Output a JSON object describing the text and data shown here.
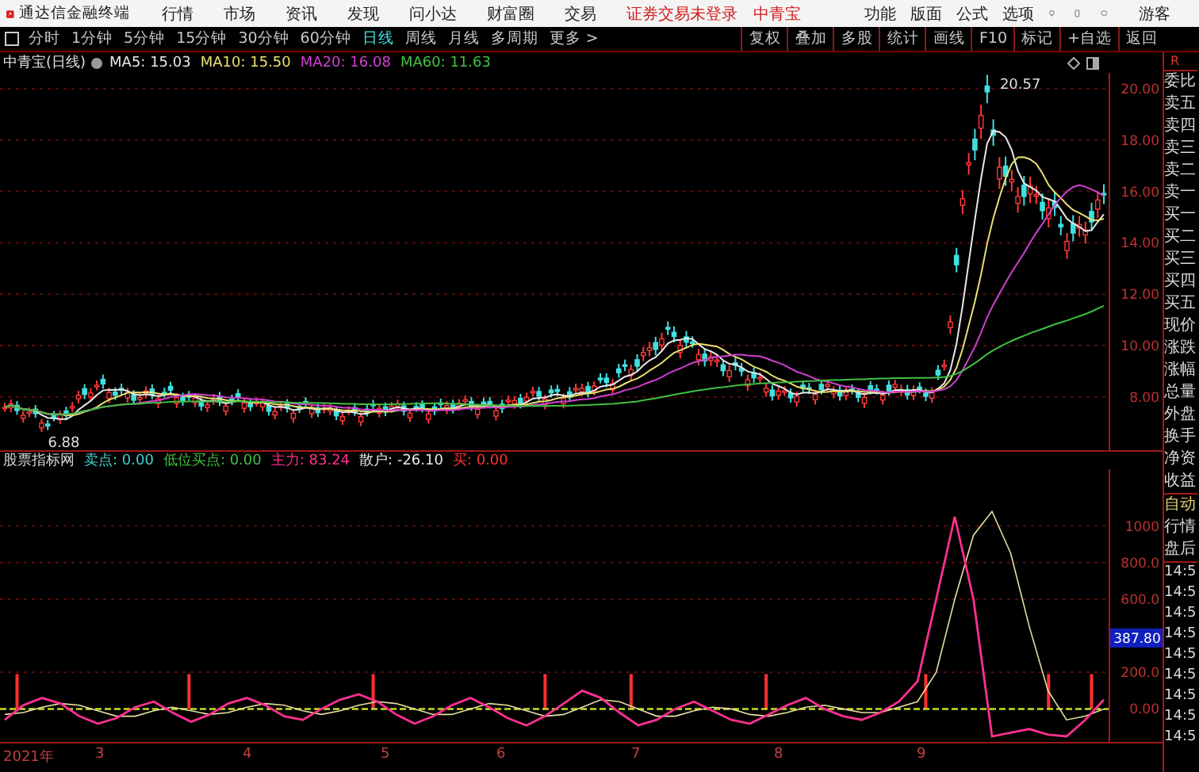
{
  "menu_bar": {
    "app_title": "通达信金融终端",
    "items": [
      "行情",
      "市场",
      "资讯",
      "发现",
      "问小达",
      "财富圈",
      "交易"
    ],
    "notice": "证券交易未登录",
    "stock": "中青宝",
    "right_items": [
      "功能",
      "版面",
      "公式",
      "选项"
    ],
    "user": "游客"
  },
  "toolbar": {
    "periods": [
      {
        "label": "分时",
        "selected": false
      },
      {
        "label": "1分钟",
        "selected": false
      },
      {
        "label": "5分钟",
        "selected": false
      },
      {
        "label": "15分钟",
        "selected": false
      },
      {
        "label": "30分钟",
        "selected": false
      },
      {
        "label": "60分钟",
        "selected": false
      },
      {
        "label": "日线",
        "selected": true
      },
      {
        "label": "周线",
        "selected": false
      },
      {
        "label": "月线",
        "selected": false
      },
      {
        "label": "多周期",
        "selected": false
      },
      {
        "label": "更多 >",
        "selected": false
      }
    ],
    "buttons": [
      "复权",
      "叠加",
      "多股",
      "统计",
      "画线",
      "F10",
      "标记",
      "+自选",
      "返回"
    ]
  },
  "chart_header": {
    "title": "中青宝(日线)",
    "ma": [
      {
        "label": "MA5: 15.03",
        "color": "#e8e8e8"
      },
      {
        "label": "MA10: 15.50",
        "color": "#e8e070"
      },
      {
        "label": "MA20: 16.08",
        "color": "#d040d0"
      },
      {
        "label": "MA60: 11.63",
        "color": "#40c040"
      }
    ]
  },
  "price_chart": {
    "high_label": "20.57",
    "low_label": "6.88",
    "axis": [
      "20.00",
      "18.00",
      "16.00",
      "14.00",
      "12.00",
      "10.00",
      "8.00"
    ]
  },
  "indicator": {
    "name": "股票指标网",
    "values": [
      {
        "label": "卖点: 0.00",
        "color": "#40d0d0"
      },
      {
        "label": "低位买点: 0.00",
        "color": "#40c040"
      },
      {
        "label": "主力: 83.24",
        "color": "#ff3090"
      },
      {
        "label": "散户: -26.10",
        "color": "#e8e8e8"
      },
      {
        "label": "买: 0.00",
        "color": "#ff3030"
      }
    ],
    "current": "387.80",
    "chart_data": {
      "type": "line",
      "ylim": [
        -180,
        1310
      ],
      "grid": true,
      "ref_lines": [
        {
          "value": 0,
          "axis": "y",
          "color": "#c8e020"
        }
      ],
      "yticks": [
        {
          "value": 1000,
          "label": "1000"
        },
        {
          "value": 800,
          "label": "800.0"
        },
        {
          "value": 600,
          "label": "600.0"
        },
        {
          "value": 200,
          "label": "200.0"
        },
        {
          "value": 0,
          "label": "0.00"
        }
      ],
      "series": [
        {
          "color": "#ff3090",
          "values": [
            -60,
            20,
            60,
            30,
            -40,
            -80,
            -50,
            10,
            40,
            -20,
            -70,
            -30,
            30,
            60,
            20,
            -40,
            -60,
            0,
            50,
            80,
            40,
            -30,
            -80,
            -40,
            20,
            60,
            10,
            -50,
            -90,
            -40,
            30,
            100,
            60,
            -20,
            -90,
            -60,
            0,
            40,
            -10,
            -60,
            -80,
            -30,
            20,
            60,
            0,
            -40,
            -60,
            -20,
            40,
            150,
            600,
            1050,
            600,
            -150,
            -130,
            -110,
            -140,
            -150,
            -60,
            50
          ]
        },
        {
          "color": "#e8e0a0",
          "values": [
            -30,
            -20,
            10,
            30,
            20,
            -10,
            -40,
            -40,
            -10,
            10,
            -10,
            -30,
            -20,
            10,
            30,
            20,
            -10,
            -30,
            -10,
            20,
            40,
            30,
            0,
            -30,
            -30,
            0,
            30,
            20,
            -10,
            -40,
            -30,
            10,
            50,
            40,
            0,
            -40,
            -40,
            -10,
            10,
            0,
            -30,
            -40,
            -20,
            10,
            20,
            0,
            -20,
            -20,
            10,
            40,
            200,
            600,
            950,
            1080,
            850,
            450,
            100,
            -60,
            -40,
            0
          ]
        }
      ]
    }
  },
  "x_axis": [
    "2021年",
    "3",
    "4",
    "5",
    "6",
    "7",
    "8",
    "9"
  ],
  "side_panel": {
    "corner": "R",
    "quote": [
      "委比",
      "卖五",
      "卖四",
      "卖三",
      "卖二",
      "卖一",
      "买一",
      "买二",
      "买三",
      "买四",
      "买五",
      "现价",
      "涨跌",
      "涨幅",
      "总量",
      "外盘",
      "换手",
      "净资",
      "收益"
    ],
    "status": [
      "自动",
      "行情",
      "盘后"
    ],
    "times": [
      "14:5",
      "14:5",
      "14:5",
      "14:5",
      "14:5",
      "14:5",
      "14:5",
      "14:5",
      "14:5"
    ]
  }
}
